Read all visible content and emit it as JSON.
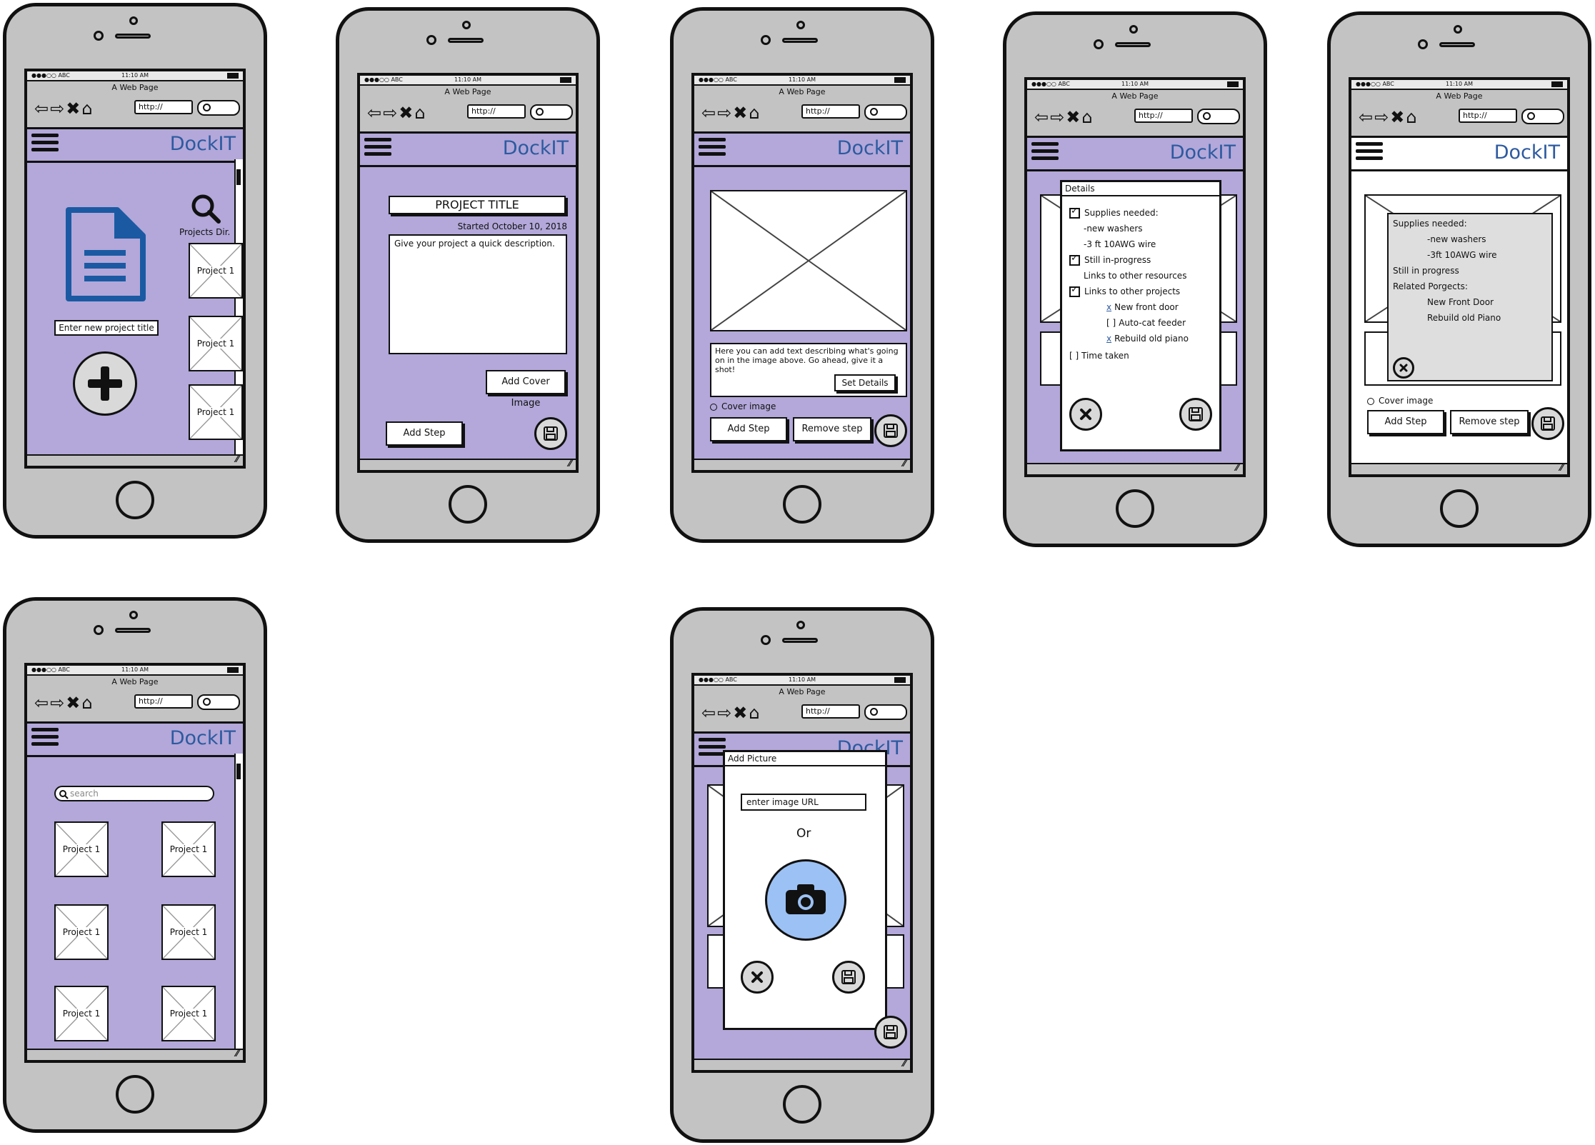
{
  "browser": {
    "status_left": "●●●○○ ABC",
    "status_time": "11:10 AM",
    "page_title": "A Web Page",
    "url": "http://",
    "nav_glyphs": "⇦⇨✖⌂"
  },
  "app": {
    "brand": "DockIT"
  },
  "screen1": {
    "projects_dir_label": "Projects Dir.",
    "new_title_placeholder": "Enter new project title",
    "projects": [
      "Project 1",
      "Project 1",
      "Project 1"
    ]
  },
  "screen2": {
    "title": "PROJECT TITLE",
    "started": "Started October 10, 2018",
    "description": "Give your project a quick description.",
    "add_cover_label": "Add Cover Image",
    "add_step_label": "Add Step"
  },
  "screen3": {
    "step_text": "Here you can add text describing what's going on in the image above.  Go ahead, give it a shot!",
    "set_details_label": "Set Details",
    "cover_image_label": "Cover image",
    "add_step_label": "Add Step",
    "remove_step_label": "Remove step"
  },
  "screen4": {
    "dialog_title": "Details",
    "supplies_label": "Supplies needed:",
    "supply1": "-new washers",
    "supply2": "-3 ft 10AWG wire",
    "in_progress_label": "Still in-progress",
    "links_resources_label": "Links to other resources",
    "links_projects_label": "Links to other projects",
    "link1_mark": "x",
    "link1": "New front door",
    "link2_mark": "[  ]",
    "link2": "Auto-cat feeder",
    "link3_mark": "x",
    "link3": "Rebuild old piano",
    "time_taken_label": "[  ]  Time taken"
  },
  "screen5": {
    "supplies_label": "Supplies needed:",
    "supply1": "-new washers",
    "supply2": "-3ft 10AWG wire",
    "in_progress": "Still in progress",
    "related_label": "Related Porgects:",
    "related1": "New Front Door",
    "related2": "Rebuild old Piano",
    "cover_image_label": "Cover image",
    "add_step_label": "Add Step",
    "remove_step_label": "Remove step"
  },
  "screen6": {
    "search_placeholder": "search",
    "projects": [
      "Project 1",
      "Project 1",
      "Project 1",
      "Project 1",
      "Project 1",
      "Project 1"
    ]
  },
  "screen7": {
    "dialog_title": "Add Picture",
    "url_placeholder": "enter image URL",
    "or_label": "Or"
  },
  "colors": {
    "app_bg": "#b3a8d9",
    "brand": "#2d5aa0",
    "camera_button": "#9cc1f4",
    "document_icon": "#1b5aa3"
  },
  "icons": [
    "menu-icon",
    "search-icon",
    "document-icon",
    "plus-icon",
    "save-icon",
    "close-icon",
    "camera-icon"
  ]
}
